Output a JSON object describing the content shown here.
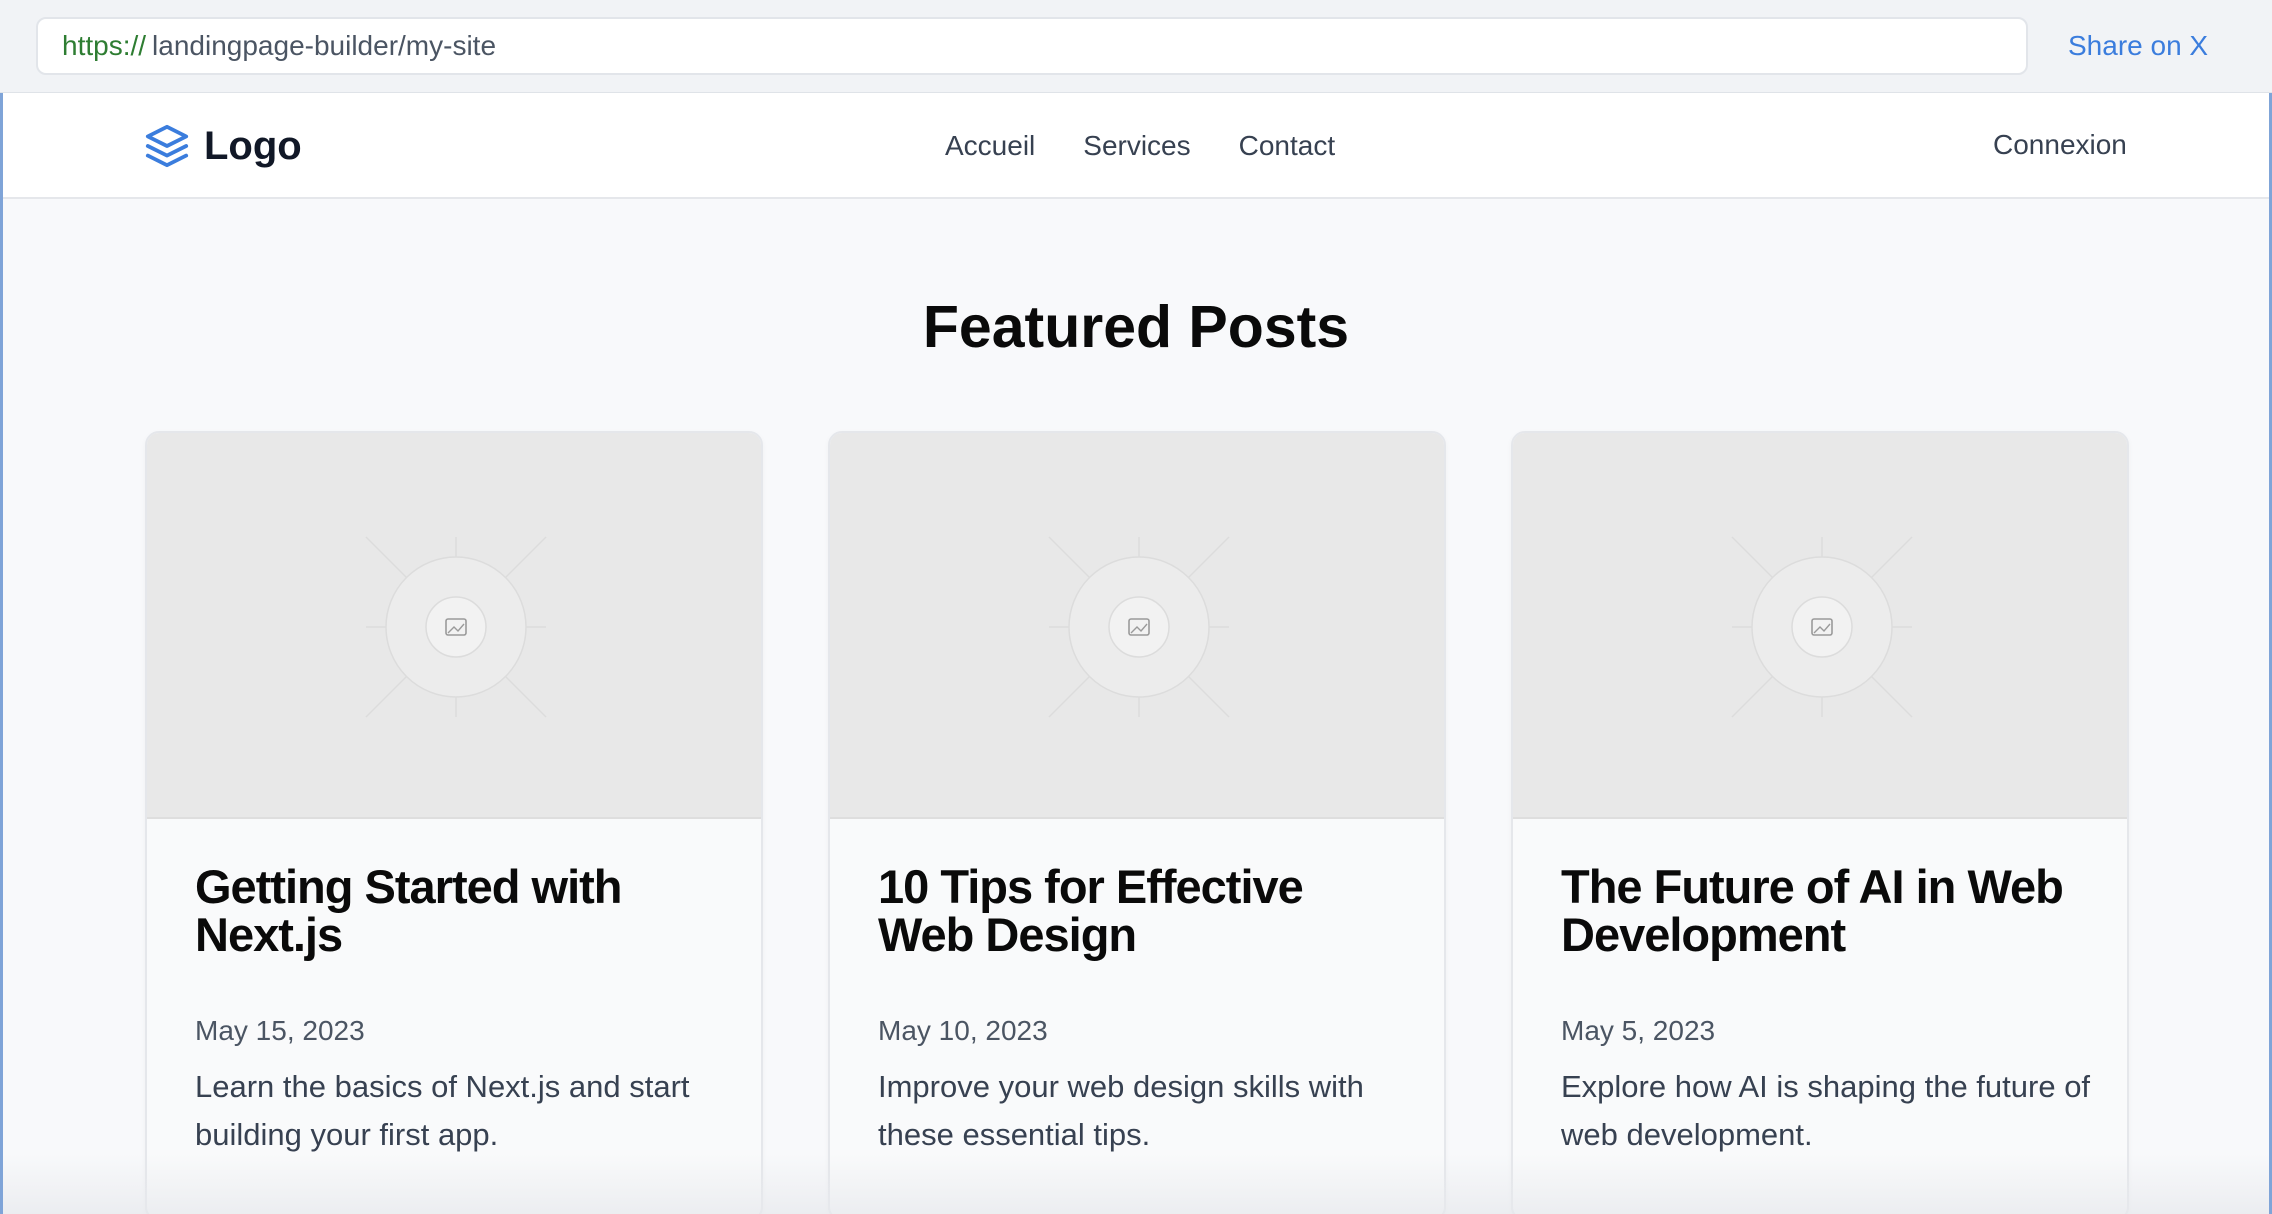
{
  "browser": {
    "url_scheme": "https://",
    "url_path": "landingpage-builder/my-site",
    "share_label": "Share on X"
  },
  "header": {
    "logo_text": "Logo",
    "nav": [
      {
        "label": "Accueil"
      },
      {
        "label": "Services"
      },
      {
        "label": "Contact"
      }
    ],
    "login_label": "Connexion"
  },
  "main": {
    "section_title": "Featured Posts",
    "posts": [
      {
        "title": "Getting Started with Next.js",
        "date": "May 15, 2023",
        "description": "Learn the basics of Next.js and start building your first app."
      },
      {
        "title": "10 Tips for Effective Web Design",
        "date": "May 10, 2023",
        "description": "Improve your web design skills with these essential tips."
      },
      {
        "title": "The Future of AI in Web Development",
        "date": "May 5, 2023",
        "description": "Explore how AI is shaping the future of web development."
      }
    ]
  },
  "colors": {
    "accent": "#3b7ddd",
    "url_scheme": "#2e7d32",
    "frame_border": "#7fa4d8"
  },
  "icons": {
    "logo": "layers-icon",
    "placeholder": "image-placeholder-icon"
  }
}
